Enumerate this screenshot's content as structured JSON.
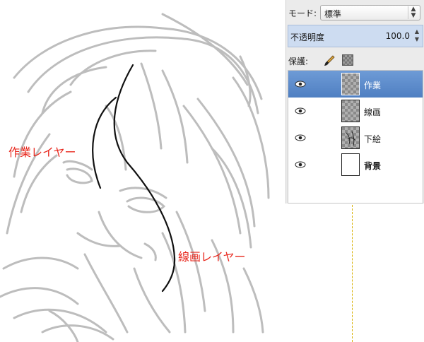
{
  "annotations": {
    "work_layer": "作業レイヤー",
    "line_layer": "線画レイヤー"
  },
  "panel": {
    "mode_label": "モード:",
    "mode_value": "標準",
    "opacity_label": "不透明度",
    "opacity_value": "100.0",
    "protect_label": "保護:",
    "layers": [
      {
        "name": "作業",
        "selected": true,
        "thumb": "checker",
        "icon": "eye-icon"
      },
      {
        "name": "線画",
        "selected": false,
        "thumb": "checker",
        "icon": "eye-icon"
      },
      {
        "name": "下絵",
        "selected": false,
        "thumb": "checker-sketch",
        "icon": "eye-icon"
      },
      {
        "name": "背景",
        "selected": false,
        "thumb": "white",
        "icon": "eye-icon"
      }
    ]
  },
  "colors": {
    "annotation": "#e8281e",
    "selection": "#5a88c9",
    "opacity_bg": "#cddcf1",
    "guide": "#d8b000"
  }
}
